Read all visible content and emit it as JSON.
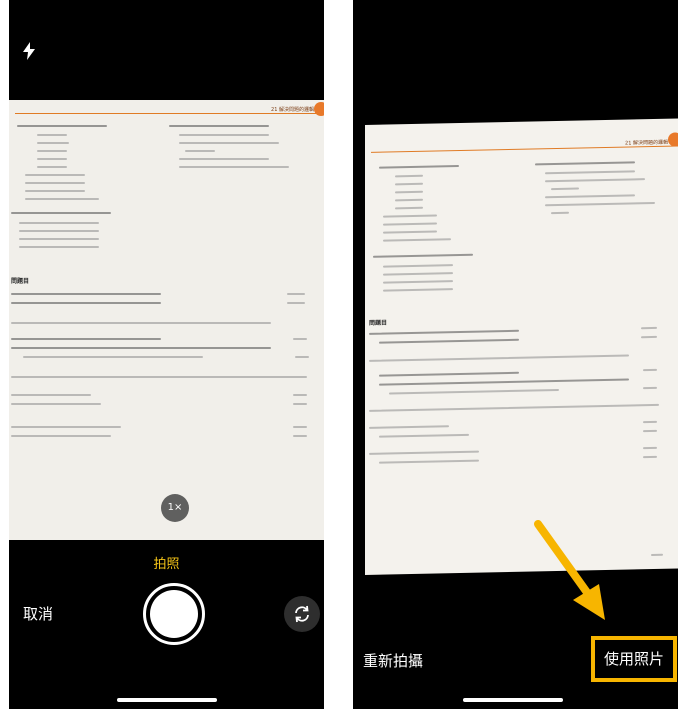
{
  "left_screen": {
    "flash_icon": "lightning-bolt-icon",
    "zoom_label": "1×",
    "mode_label": "拍照",
    "cancel_label": "取消",
    "shutter_icon": "shutter-icon",
    "flip_icon": "camera-flip-icon",
    "document": {
      "header": "21 解決問題的邏輯",
      "section_title": "問題目"
    }
  },
  "right_screen": {
    "document": {
      "header": "21 解決問題的邏輯",
      "section_title": "問題目"
    },
    "retake_label": "重新拍攝",
    "use_photo_label": "使用照片",
    "highlight_color": "#f7b500",
    "arrow_icon": "arrow-pointer-icon"
  }
}
